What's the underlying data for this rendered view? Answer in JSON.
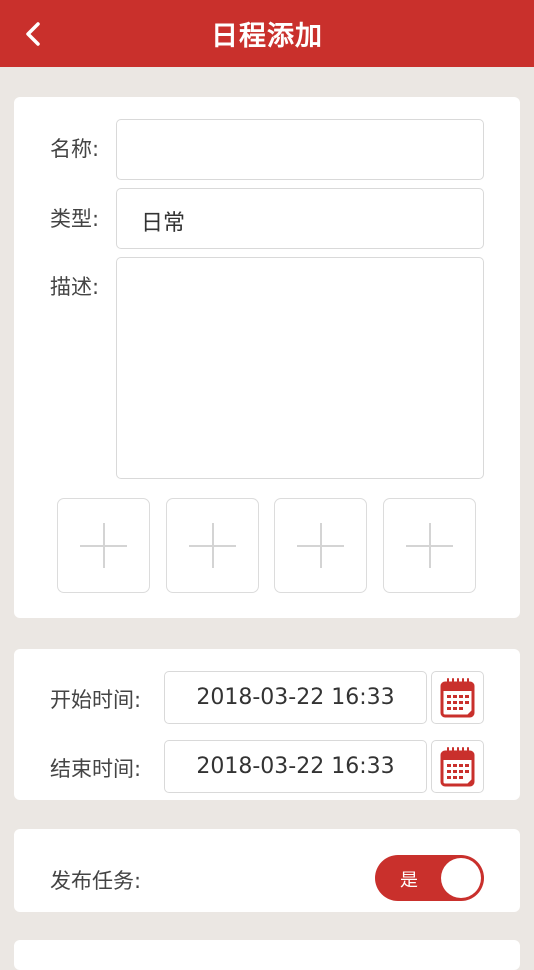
{
  "header": {
    "title": "日程添加",
    "back_icon": "chevron-left-icon"
  },
  "form": {
    "name": {
      "label": "名称:",
      "value": ""
    },
    "type": {
      "label": "类型:",
      "value": "日常"
    },
    "description": {
      "label": "描述:",
      "value": ""
    },
    "attachments": [
      {
        "icon": "plus-icon"
      },
      {
        "icon": "plus-icon"
      },
      {
        "icon": "plus-icon"
      },
      {
        "icon": "plus-icon"
      }
    ]
  },
  "time": {
    "start": {
      "label": "开始时间:",
      "value": "2018-03-22 16:33",
      "icon": "calendar-icon"
    },
    "end": {
      "label": "结束时间:",
      "value": "2018-03-22 16:33",
      "icon": "calendar-icon"
    }
  },
  "publish": {
    "label": "发布任务:",
    "toggle_text": "是",
    "enabled": true
  },
  "colors": {
    "accent": "#c9302c",
    "background": "#ebe7e3"
  }
}
